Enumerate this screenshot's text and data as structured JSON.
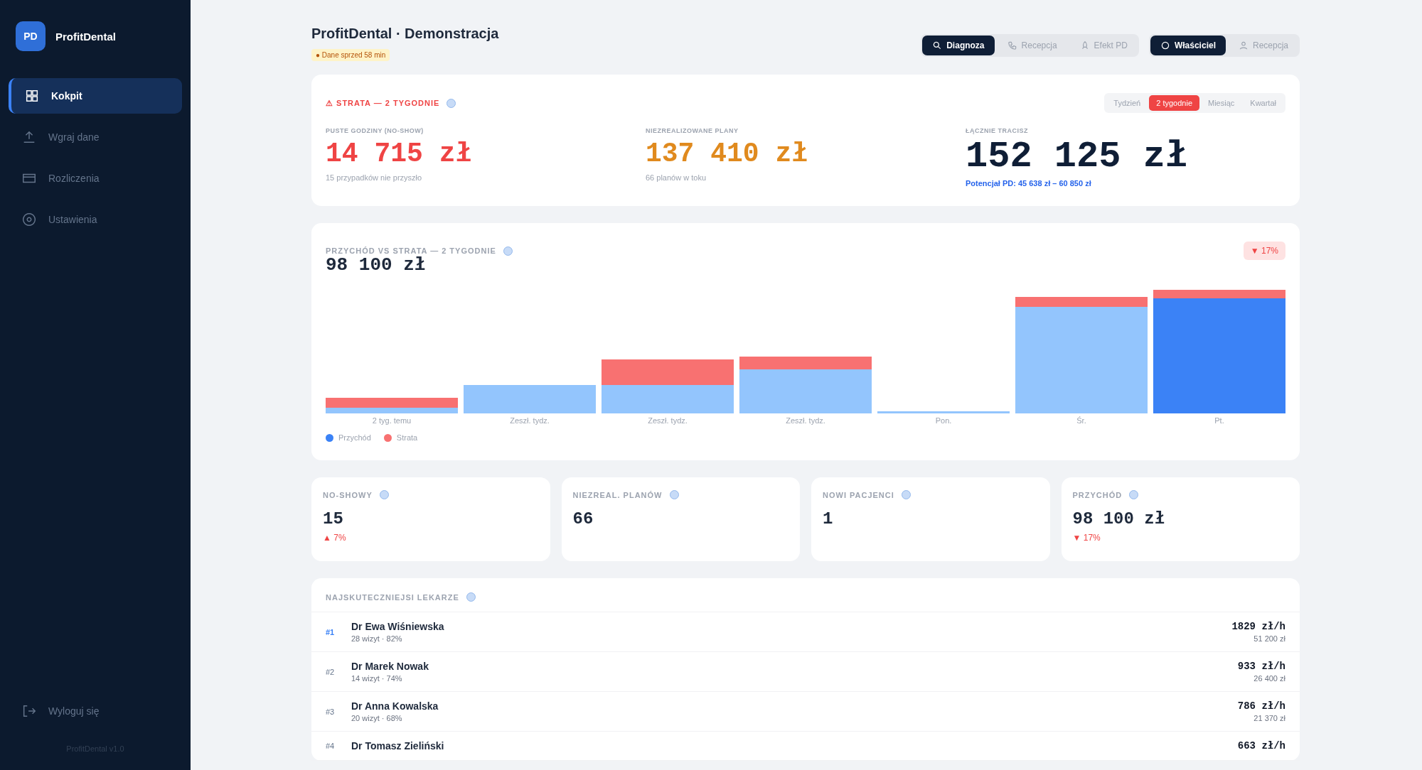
{
  "sidebar": {
    "logo": "PD",
    "brand": "ProfitDental",
    "items": [
      {
        "label": "Kokpit",
        "selected": true
      },
      {
        "label": "Wgraj dane",
        "selected": false
      },
      {
        "label": "Rozliczenia",
        "selected": false
      },
      {
        "label": "Ustawienia",
        "selected": false
      }
    ],
    "logout": "Wyloguj się",
    "version": "ProfitDental v1.0"
  },
  "header": {
    "title": "ProfitDental · Demonstracja",
    "badge": "● Dane sprzed 58 min",
    "view_buttons": [
      {
        "label": "Diagnoza",
        "selected": true
      },
      {
        "label": "Recepcja",
        "selected": false
      },
      {
        "label": "Efekt PD",
        "selected": false
      }
    ],
    "role_buttons": [
      {
        "label": "Właściciel",
        "selected": true
      },
      {
        "label": "Recepcja",
        "selected": false
      }
    ]
  },
  "loss_card": {
    "title": "⚠ STRATA — 2 TYGODNIE",
    "periods": [
      {
        "label": "Tydzień",
        "selected": false
      },
      {
        "label": "2 tygodnie",
        "selected": true
      },
      {
        "label": "Miesiąc",
        "selected": false
      },
      {
        "label": "Kwartał",
        "selected": false
      }
    ],
    "metrics": [
      {
        "label": "PUSTE GODZINY (NO-SHOW)",
        "value": "14 715 zł",
        "note": "15 przypadków nie przyszło",
        "kind": "red"
      },
      {
        "label": "NIEZREALIZOWANE PLANY",
        "value": "137 410 zł",
        "note": "66 planów w toku",
        "kind": "orange"
      },
      {
        "label": "ŁĄCZNIE TRACISZ",
        "value": "152 125 zł",
        "note": "Potencjał PD: 45 638 zł – 60 850 zł",
        "kind": "total"
      }
    ]
  },
  "revenue_card": {
    "title": "PRZYCHÓD VS STRATA — 2 TYGODNIE",
    "value": "98 100 zł",
    "change": "▼ 17%",
    "chart_labels": [
      "2 tyg. temu",
      "Zeszł. tydz.",
      "Zeszł. tydz.",
      "Zeszł. tydz.",
      "Pon.",
      "Śr.",
      "Pt."
    ],
    "legend": [
      {
        "label": "Przychód",
        "color": "#3b82f6"
      },
      {
        "label": "Strata",
        "color": "#f87171"
      }
    ]
  },
  "kpis": [
    {
      "label": "NO-SHOWY",
      "value": "15",
      "change": "▲ 7%"
    },
    {
      "label": "NIEZREAL. PLANÓW",
      "value": "66"
    },
    {
      "label": "NOWI PACJENCI",
      "value": "1"
    },
    {
      "label": "PRZYCHÓD",
      "value": "98 100 zł",
      "change": "▼ 17%"
    }
  ],
  "doctors": {
    "title": "NAJSKUTECZNIEJSI LEKARZE",
    "rows": [
      {
        "rank": "#1",
        "name": "Dr Ewa Wiśniewska",
        "detail": "28 wizyt · 82%",
        "rate": "1829 zł/h",
        "total": "51 200 zł",
        "selected": true
      },
      {
        "rank": "#2",
        "name": "Dr Marek Nowak",
        "detail": "14 wizyt · 74%",
        "rate": "933 zł/h",
        "total": "26 400 zł",
        "selected": false
      },
      {
        "rank": "#3",
        "name": "Dr Anna Kowalska",
        "detail": "20 wizyt · 68%",
        "rate": "786 zł/h",
        "total": "21 370 zł",
        "selected": false
      },
      {
        "rank": "#4",
        "name": "Dr Tomasz Zieliński",
        "rate": "663 zł/h",
        "selected": false
      }
    ]
  }
}
